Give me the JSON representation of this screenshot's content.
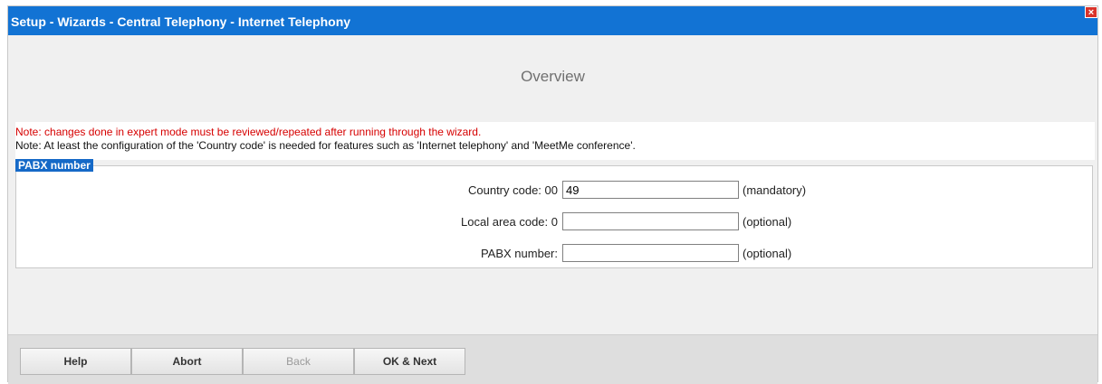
{
  "window": {
    "title": "Setup - Wizards - Central Telephony - Internet Telephony",
    "close_symbol": "×"
  },
  "page": {
    "heading": "Overview"
  },
  "notes": {
    "warning": "Note: changes done in expert mode must be reviewed/repeated after running through the wizard.",
    "info": "Note: At least the configuration of the 'Country code' is needed for features such as 'Internet telephony' and 'MeetMe conference'."
  },
  "pabx": {
    "legend": "PABX number",
    "fields": [
      {
        "label": "Country code: 00",
        "value": "49",
        "hint": "(mandatory)"
      },
      {
        "label": "Local area code: 0",
        "value": "",
        "hint": "(optional)"
      },
      {
        "label": "PABX number:",
        "value": "",
        "hint": "(optional)"
      }
    ]
  },
  "buttons": {
    "help": "Help",
    "abort": "Abort",
    "back": "Back",
    "ok_next": "OK & Next"
  },
  "colors": {
    "titlebar": "#1273d4",
    "warning_text": "#d60000",
    "legend_bg": "#1569c7"
  }
}
